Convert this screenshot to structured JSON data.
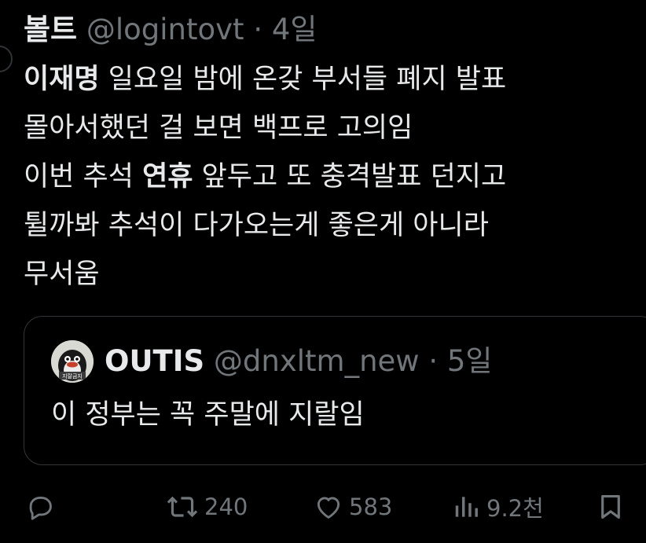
{
  "tweet": {
    "author_name": "볼트",
    "author_handle": "@logintovt",
    "separator": "·",
    "time": "4일",
    "lines": [
      {
        "bold": "이재명",
        "rest": " 일요일 밤에 온갖 부서들 폐지 발표"
      },
      {
        "bold": "",
        "rest": "몰아서했던 걸 보면 백프로 고의임"
      },
      {
        "pre": "이번 추석 ",
        "bold": "연휴",
        "rest": " 앞두고 또 충격발표 던지고"
      },
      {
        "bold": "",
        "rest": "튈까봐 추석이 다가오는게 좋은게 아니라"
      },
      {
        "bold": "",
        "rest": "무서움"
      }
    ]
  },
  "quote": {
    "author_name": "OUTIS",
    "author_handle": "@dnxltm_new",
    "separator": "·",
    "time": "5일",
    "text": "이 정부는 꼭 주말에 지랄임",
    "avatar_label": "지랄금지"
  },
  "actions": {
    "reply_icon": "reply-icon",
    "retweet_count": "240",
    "like_count": "583",
    "views_count": "9.2천",
    "bookmark_icon": "bookmark-icon"
  },
  "colors": {
    "background": "#000000",
    "text": "#e7e9ea",
    "muted": "#71767b",
    "border": "#333639"
  }
}
